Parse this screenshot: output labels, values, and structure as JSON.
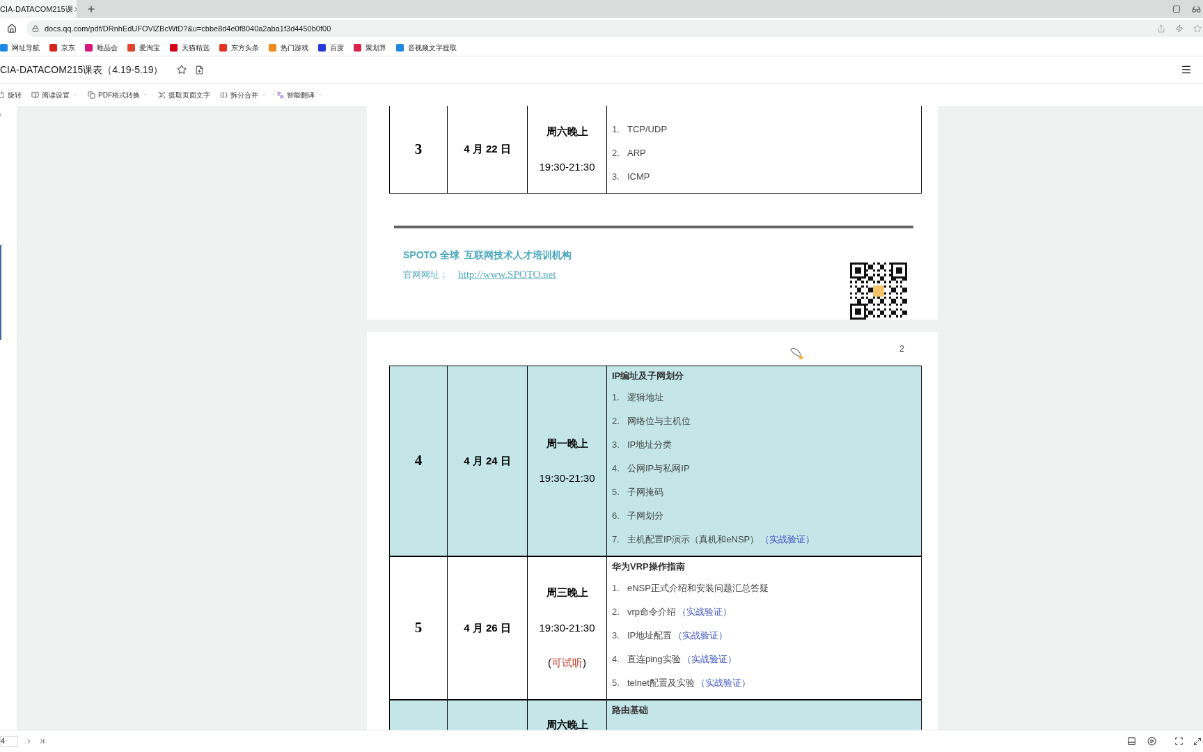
{
  "browser": {
    "tab_title": "CIA-DATACOM215课",
    "url": "docs.qq.com/pdf/DRnhEdUFOVlZBcWtD?&u=cbbe8d4e0f8040a2aba1f3d4450b0f00",
    "bookmarks": [
      {
        "label": "网址导航",
        "color": "#1e88e5"
      },
      {
        "label": "京东",
        "color": "#d9251c"
      },
      {
        "label": "唯品会",
        "color": "#d6167a"
      },
      {
        "label": "爱淘宝",
        "color": "#e0442b"
      },
      {
        "label": "天猫精选",
        "color": "#d40016"
      },
      {
        "label": "东方头条",
        "color": "#e53323"
      },
      {
        "label": "热门游戏",
        "color": "#f08a1c"
      },
      {
        "label": "百度",
        "color": "#2a3ad8"
      },
      {
        "label": "聚划算",
        "color": "#d8244a"
      },
      {
        "label": "音视频文字提取",
        "color": "#1e88e5"
      }
    ]
  },
  "doc": {
    "title": "CIA-DATACOM215课表（4.19-5.19）",
    "toolbar": [
      {
        "label": "旋转",
        "dropdown": false
      },
      {
        "label": "阅读设置",
        "dropdown": true
      },
      {
        "label": "PDF格式转换",
        "dropdown": true
      },
      {
        "label": "提取页面文字",
        "dropdown": false
      },
      {
        "label": "拆分合并",
        "dropdown": true
      },
      {
        "label": "智能翻译",
        "dropdown": true
      }
    ]
  },
  "pages": [
    {
      "rows": [
        {
          "number": "3",
          "date": "4 月 22 日",
          "day": "周六晚上",
          "time": "19:30-21:30",
          "highlighted": false,
          "items": [
            {
              "num": "1.",
              "text": "TCP/UDP"
            },
            {
              "num": "2.",
              "text": "ARP"
            },
            {
              "num": "3.",
              "text": "ICMP"
            }
          ]
        }
      ],
      "footer": {
        "org": "SPOTO 全球  互联网技术人才培训机构",
        "site_label": "官网网址：",
        "site_url": "http://www.SPOTO.net"
      }
    },
    {
      "page_number": "2",
      "rows": [
        {
          "number": "4",
          "date": "4 月 24 日",
          "day": "周一晚上",
          "time": "19:30-21:30",
          "highlighted": true,
          "heading": "IP编址及子网划分",
          "items": [
            {
              "num": "1.",
              "text": "逻辑地址"
            },
            {
              "num": "2.",
              "text": "网络位与主机位"
            },
            {
              "num": "3.",
              "text": "IP地址分类"
            },
            {
              "num": "4.",
              "text": "公网IP与私网IP"
            },
            {
              "num": "5.",
              "text": "子网掩码"
            },
            {
              "num": "6.",
              "text": "子网划分"
            },
            {
              "num": "7.",
              "text": "主机配置IP演示（真机和eNSP）",
              "tag": "（实战验证）"
            }
          ]
        },
        {
          "number": "5",
          "date": "4 月 26 日",
          "day": "周三晚上",
          "time": "19:30-21:30",
          "trial": {
            "open": "(",
            "text": "可试听",
            "close": ")"
          },
          "highlighted": false,
          "heading": "华为VRP操作指南",
          "items": [
            {
              "num": "1.",
              "text": "eNSP正式介绍和安装问题汇总答疑"
            },
            {
              "num": "2.",
              "text": "vrp命令介绍",
              "tag": "（实战验证）"
            },
            {
              "num": "3.",
              "text": "IP地址配置",
              "tag": "（实战验证）"
            },
            {
              "num": "4.",
              "text": "直连ping实验",
              "tag": "（实战验证）"
            },
            {
              "num": "5.",
              "text": "telnet配置及实验",
              "tag": "（实战验证）"
            }
          ]
        },
        {
          "day": "周六晚上",
          "highlighted": true,
          "heading": "路由基础"
        }
      ]
    }
  ],
  "pager": {
    "page": "4"
  }
}
